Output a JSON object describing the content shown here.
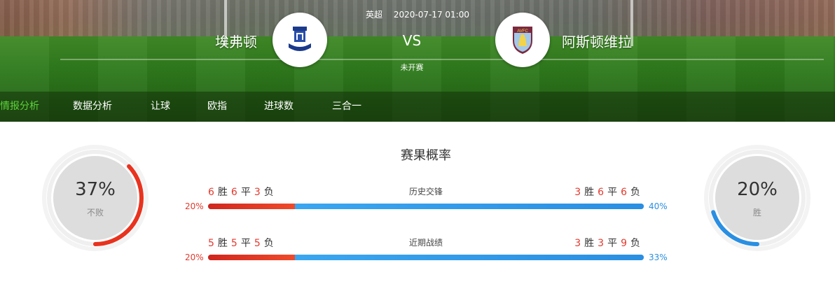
{
  "match": {
    "league": "英超",
    "datetime": "2020-07-17 01:00",
    "vs": "VS",
    "status": "未开赛",
    "home_team": "埃弗顿",
    "away_team": "阿斯顿维拉",
    "home_logo": "everton-crest-icon",
    "away_logo": "aston-villa-crest-icon"
  },
  "tabs": [
    {
      "label": "情报分析",
      "active": true
    },
    {
      "label": "数据分析",
      "active": false
    },
    {
      "label": "让球",
      "active": false
    },
    {
      "label": "欧指",
      "active": false
    },
    {
      "label": "进球数",
      "active": false
    },
    {
      "label": "三合一",
      "active": false
    }
  ],
  "probability": {
    "title": "赛果概率",
    "left": {
      "percent": "37%",
      "label": "不败",
      "value": 0.37,
      "color": "#e8331f"
    },
    "right": {
      "percent": "20%",
      "label": "胜",
      "value": 0.2,
      "color": "#2a8fe2"
    },
    "rows": [
      {
        "label": "历史交锋",
        "home": {
          "w": "6",
          "d": "6",
          "l": "3"
        },
        "away": {
          "w": "3",
          "d": "6",
          "l": "6"
        },
        "home_pct": "20%",
        "away_pct": "40%",
        "home_value": 20,
        "away_value": 40
      },
      {
        "label": "近期战绩",
        "home": {
          "w": "5",
          "d": "5",
          "l": "5"
        },
        "away": {
          "w": "3",
          "d": "3",
          "l": "9"
        },
        "home_pct": "20%",
        "away_pct": "33%",
        "home_value": 20,
        "away_value": 33
      }
    ],
    "units": {
      "w": "胜",
      "d": "平",
      "l": "负"
    }
  }
}
